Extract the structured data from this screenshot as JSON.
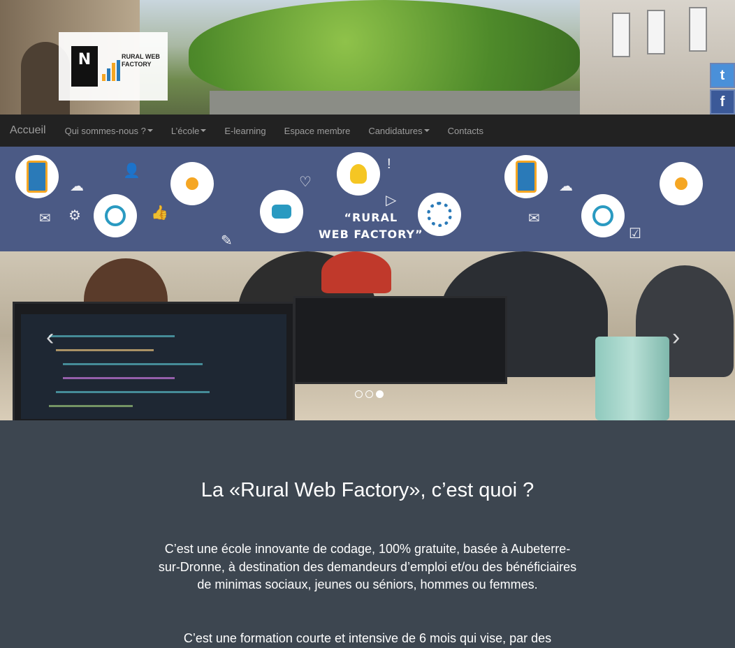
{
  "header": {
    "logo": {
      "mark": "N",
      "text": "RURAL WEB FACTORY"
    },
    "social": [
      {
        "icon": "twitter-icon",
        "glyph": "t"
      },
      {
        "icon": "facebook-icon",
        "glyph": "f"
      }
    ]
  },
  "nav": {
    "brand": "Accueil",
    "items": [
      {
        "label": "Qui sommes-nous ?",
        "dropdown": true
      },
      {
        "label": "L’école",
        "dropdown": true
      },
      {
        "label": "E-learning",
        "dropdown": false
      },
      {
        "label": "Espace membre",
        "dropdown": false
      },
      {
        "label": "Candidatures",
        "dropdown": true
      },
      {
        "label": "Contacts",
        "dropdown": false
      }
    ]
  },
  "banner": {
    "title_line1": "“RURAL",
    "title_line2": "WEB FACTORY”",
    "background_color": "#4b5a85"
  },
  "carousel": {
    "prev": "‹",
    "next": "›",
    "indicator_count": 3,
    "active_indicator": 3
  },
  "main": {
    "heading": "La «Rural Web Factory», c’est quoi ?",
    "paragraph1": "C’est une école innovante de codage, 100% gratuite, basée à Aubeterre-sur-Dronne, à destination des demandeurs d’emploi et/ou des bénéficiaires de minimas sociaux, jeunes ou séniors, hommes ou femmes.",
    "paragraph2": "C’est une formation courte et intensive de 6 mois qui vise, par des"
  },
  "colors": {
    "nav_bg": "#222222",
    "content_bg": "#3d4650",
    "nav_text": "#9d9d9d"
  }
}
